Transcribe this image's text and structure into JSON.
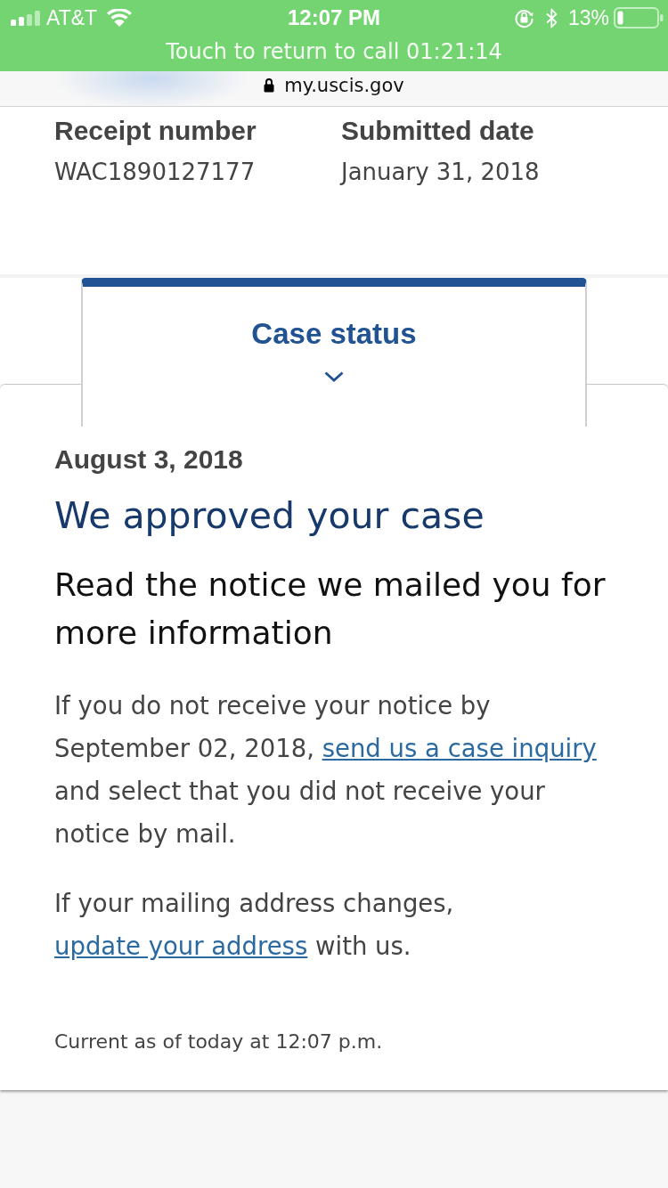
{
  "status_bar": {
    "carrier": "AT&T",
    "time": "12:07 PM",
    "battery_percent": "13%",
    "call_banner": "Touch to return to call 01:21:14"
  },
  "address_bar": {
    "url": "my.uscis.gov"
  },
  "case_summary": [
    {
      "label": "Receipt number",
      "value": "WAC1890127177"
    },
    {
      "label": "Submitted date",
      "value": "January 31, 2018"
    }
  ],
  "tabs": [
    {
      "label": "Case status",
      "selected": true
    }
  ],
  "case_status": {
    "date": "August 3, 2018",
    "title": "We approved your case",
    "subtitle": "Read the notice we mailed you for more information",
    "paragraphs": [
      [
        {
          "kind": "text",
          "text": "If you do not receive your notice by September 02, 2018, "
        },
        {
          "kind": "link",
          "text": "send us a case inquiry"
        },
        {
          "kind": "text",
          "text": " and select that you did not receive your notice by mail."
        }
      ],
      [
        {
          "kind": "text",
          "text": "If your mailing address changes, "
        },
        {
          "kind": "link",
          "text": "update your address"
        },
        {
          "kind": "text",
          "text": " with us."
        }
      ]
    ],
    "updated": "Current as of today at 12:07 p.m."
  }
}
